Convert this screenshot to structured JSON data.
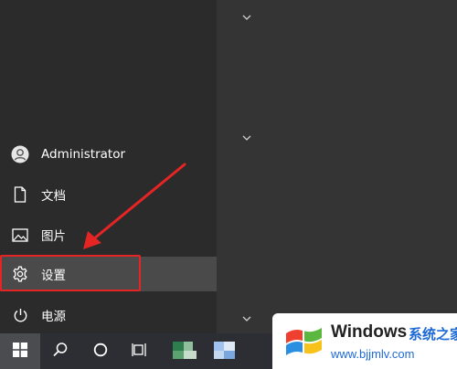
{
  "start_menu": {
    "items": [
      {
        "label": "Administrator",
        "icon": "user-avatar-icon"
      },
      {
        "label": "文档",
        "icon": "document-icon"
      },
      {
        "label": "图片",
        "icon": "pictures-icon"
      },
      {
        "label": "设置",
        "icon": "gear-icon"
      },
      {
        "label": "电源",
        "icon": "power-icon"
      }
    ]
  },
  "tiles": {
    "group_toggle_icon": "chevron-down-icon"
  },
  "taskbar": {
    "icons": [
      "windows-start-icon",
      "search-icon",
      "cortana-icon",
      "task-view-icon",
      "app-icon",
      "app-icon"
    ]
  },
  "watermark": {
    "title": "Windows",
    "title_cn": "系统之家",
    "url": "www.bjjmlv.com"
  },
  "colors": {
    "annotation": "#e52424",
    "menu_bg": "#2b2b2b",
    "tile_bg": "#343434",
    "taskbar_bg": "#2d2e33",
    "watermark_blue": "#1d6ad6"
  }
}
